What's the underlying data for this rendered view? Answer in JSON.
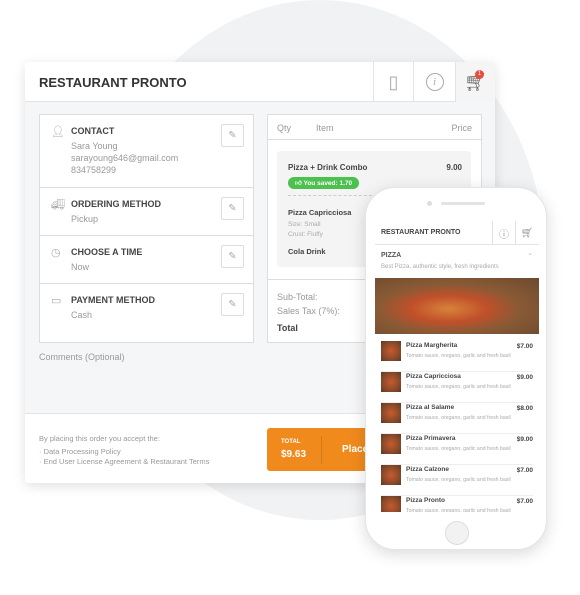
{
  "app": {
    "title": "RESTAURANT PRONTO",
    "cart_count": "1"
  },
  "contact": {
    "label": "CONTACT",
    "name": "Sara Young",
    "email": "sarayoung646@gmail.com",
    "phone": "834758299"
  },
  "ordering": {
    "label": "ORDERING METHOD",
    "value": "Pickup"
  },
  "time": {
    "label": "CHOOSE A TIME",
    "value": "Now"
  },
  "payment": {
    "label": "PAYMENT METHOD",
    "value": "Cash"
  },
  "cart": {
    "headers": {
      "qty": "Qty",
      "item": "Item",
      "price": "Price"
    },
    "combo": {
      "name": "Pizza + Drink Combo",
      "price": "9.00",
      "saved": "You saved: 1.70"
    },
    "item1": {
      "name": "Pizza Capricciosa",
      "size": "Size: Small",
      "crust": "Crust: Fluffy"
    },
    "item2": {
      "name": "Cola Drink"
    },
    "subtotal_label": "Sub-Total:",
    "tax_label": "Sales Tax (7%):",
    "total_label": "Total"
  },
  "comments_label": "Comments (Optional)",
  "footer": {
    "accept": "By placing this order you accept the:",
    "policy1": "Data Processing Policy",
    "policy2": "End User License Agreement & Restaurant Terms",
    "total_label": "TOTAL",
    "total_value": "$9.63",
    "place_label": "Place"
  },
  "mobile": {
    "title": "RESTAURANT PRONTO",
    "category": "PIZZA",
    "category_desc": "Best Pizza, authentic style, fresh ingredients",
    "items": [
      {
        "name": "Pizza Margherita",
        "price": "$7.00",
        "desc": "Tomato sauce, oregano, garlic and fresh basil"
      },
      {
        "name": "Pizza Capricciosa",
        "price": "$9.00",
        "desc": "Tomato sauce, oregano, garlic and fresh basil"
      },
      {
        "name": "Pizza al Salame",
        "price": "$8.00",
        "desc": "Tomato sauce, oregano, garlic and fresh basil"
      },
      {
        "name": "Pizza Primavera",
        "price": "$9.00",
        "desc": "Tomato sauce, oregano, garlic and fresh basil"
      },
      {
        "name": "Pizza Calzone",
        "price": "$7.00",
        "desc": "Tomato sauce, oregano, garlic and fresh basil"
      },
      {
        "name": "Pizza Pronto",
        "price": "$7.00",
        "desc": "Tomato sauce, oregano, garlic and fresh basil"
      }
    ]
  },
  "colors": {
    "accent": "#f08a1c",
    "saved_badge": "#4cc14e",
    "cart_badge": "#e84c3d"
  }
}
